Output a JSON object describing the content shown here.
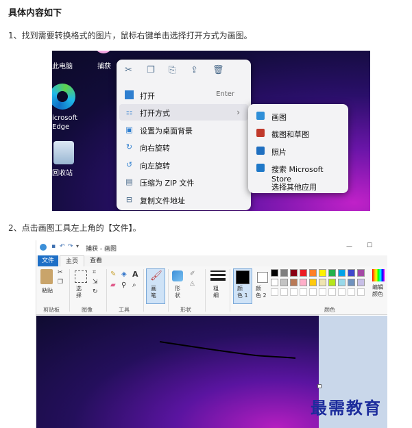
{
  "heading": "具体内容如下",
  "step1": "1、找到需要转换格式的图片，鼠标右键单击选择打开方式为画图。",
  "step2": "2、点击画图工具左上角的【文件】。",
  "shot1": {
    "desktop": {
      "this_pc": "此电脑",
      "capture": "捕获",
      "edge": "icrosoft\nEdge",
      "bin": "回收站"
    },
    "context_menu": {
      "toolbar_icons": [
        "cut-icon",
        "copy-icon",
        "rename-icon",
        "share-icon",
        "delete-icon"
      ],
      "items": [
        {
          "label": "打开",
          "shortcut": "Enter",
          "icon": "image-icon"
        },
        {
          "label": "打开方式",
          "shortcut": "›",
          "icon": "open-with-icon"
        },
        {
          "label": "设置为桌面背景",
          "shortcut": "",
          "icon": "wallpaper-icon"
        },
        {
          "label": "向右旋转",
          "shortcut": "",
          "icon": "rotate-right-icon"
        },
        {
          "label": "向左旋转",
          "shortcut": "",
          "icon": "rotate-left-icon"
        },
        {
          "label": "压缩为 ZIP 文件",
          "shortcut": "",
          "icon": "zip-icon"
        },
        {
          "label": "复制文件地址",
          "shortcut": "",
          "icon": "copy-path-icon"
        }
      ]
    },
    "submenu": {
      "items": [
        {
          "label": "画图",
          "color": "#2f8fd8"
        },
        {
          "label": "截图和草图",
          "color": "#c0392b"
        },
        {
          "label": "照片",
          "color": "#1f6fc0"
        },
        {
          "label": "搜索 Microsoft Store",
          "color": "#1f78c8"
        },
        {
          "label": "选择其他应用",
          "color": ""
        }
      ]
    }
  },
  "shot2": {
    "title": "捕获 - 画图",
    "window_controls": [
      "—",
      "☐"
    ],
    "tabs": [
      "文件",
      "主页",
      "查看"
    ],
    "groups": {
      "clipboard": "剪贴板",
      "image": "图像",
      "tools": "工具",
      "shapes": "形状",
      "colors": "颜色"
    },
    "buttons": {
      "paste": "粘贴",
      "select": "选\n择",
      "brush": "画\n笔",
      "shape": "形\n状",
      "size": "粗\n细",
      "color1": "颜\n色 1",
      "color2": "颜\n色 2",
      "edit_colors": "编辑\n颜色"
    },
    "palette_row1": [
      "#000000",
      "#7f7f7f",
      "#880015",
      "#ed1c24",
      "#ff7f27",
      "#fff200",
      "#22b14c",
      "#00a2e8",
      "#3f48cc",
      "#a349a4"
    ],
    "palette_row2": [
      "#ffffff",
      "#c3c3c3",
      "#b97a57",
      "#ffaec9",
      "#ffc90e",
      "#efe4b0",
      "#b5e61d",
      "#99d9ea",
      "#7092be",
      "#c8bfe7"
    ],
    "watermark": "最需教育"
  }
}
